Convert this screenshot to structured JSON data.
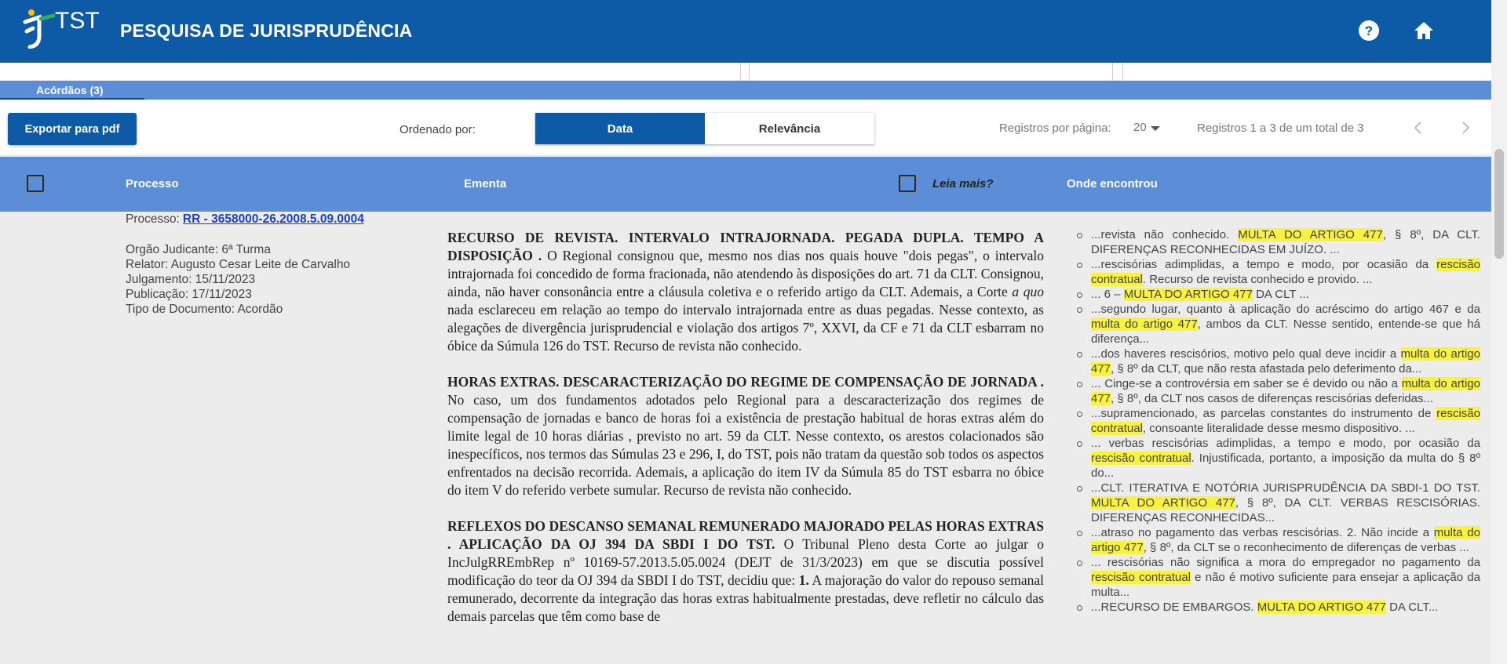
{
  "header": {
    "logo_text": "TST",
    "title": "PESQUISA DE JURISPRUDÊNCIA",
    "help_icon": "help-circle-icon",
    "home_icon": "home-icon"
  },
  "tabs": [
    {
      "label": "Acórdãos (3)",
      "active": true
    }
  ],
  "toolbar": {
    "export_label": "Exportar para pdf",
    "order_label": "Ordenado por:",
    "order_options": [
      "Data",
      "Relevância"
    ],
    "order_selected": "Data",
    "per_page_label": "Registros por página:",
    "per_page_value": "20",
    "records_text": "Registros 1 a 3 de um total de 3"
  },
  "columns": {
    "processo": "Processo",
    "ementa": "Ementa",
    "leia_mais": "Leia mais?",
    "onde": "Onde encontrou"
  },
  "result": {
    "processo_label": "Processo:",
    "processo_link": "RR - 3658000-26.2008.5.09.0004",
    "orgao": "Orgão Judicante: 6ª Turma",
    "relator": "Relator: Augusto Cesar Leite de Carvalho",
    "julgamento": "Julgamento: 15/11/2023",
    "publicacao": "Publicação: 17/11/2023",
    "tipo": "Tipo de Documento: Acordão",
    "ementa": [
      {
        "title": "RECURSO DE REVISTA. INTERVALO INTRAJORNADA. PEGADA DUPLA. TEMPO A DISPOSIÇÃO .",
        "body_a": " O Regional consignou que, mesmo nos dias nos quais houve \"dois pegas\", o intervalo intrajornada foi concedido de forma fracionada, não atendendo às disposições do art. 71 da CLT. Consignou, ainda, não haver consonância entre a cláusula coletiva e o referido artigo da CLT. Ademais, a Corte ",
        "italic": "a quo",
        "body_b": " nada esclareceu em relação ao tempo do intervalo intrajornada entre as duas pegadas. Nesse contexto, as alegações de divergência jurisprudencial e violação dos artigos 7º, XXVI, da CF e 71 da CLT esbarram no óbice da Súmula 126 do TST. Recurso de revista não conhecido."
      },
      {
        "title": "HORAS EXTRAS. DESCARACTERIZAÇÃO DO REGIME DE COMPENSAÇÃO DE JORNADA .",
        "body_a": " No caso, um dos fundamentos adotados pelo Regional para a descaracterização dos regimes de compensação de jornadas e banco de horas foi a existência de prestação habitual de horas extras além do limite legal de 10 horas diárias , previsto no art. 59 da CLT. Nesse contexto, os arestos colacionados são inespecíficos, nos termos das Súmulas 23 e 296, I, do TST, pois não tratam da questão sob todos os aspectos enfrentados na decisão recorrida. Ademais, a aplicação do item IV da Súmula 85 do TST esbarra no óbice do item V do referido verbete sumular. Recurso de revista não conhecido."
      },
      {
        "title": "REFLEXOS DO DESCANSO SEMANAL REMUNERADO MAJORADO PELAS HORAS EXTRAS . APLICAÇÃO DA OJ 394 DA SBDI I DO TST.",
        "body_a": " O Tribunal Pleno desta Corte ao julgar o IncJulgRREmbRep nº 10169-57.2013.5.05.0024 (DEJT de 31/3/2023) em que se discutia possível modificação do teor da OJ 394 da SBDI I do TST, decidiu que: ",
        "bold_tail": "1.",
        "body_b": " A majoração do valor do repouso semanal remunerado, decorrente da integração das horas extras habitualmente prestadas, deve refletir no cálculo das demais parcelas que têm como base de"
      }
    ],
    "onde": [
      [
        "...revista não conhecido. ",
        "MULTA DO ARTIGO 477",
        ", § 8º, DA CLT. DIFERENÇAS RECONHECIDAS EM JUÍZO. ..."
      ],
      [
        "...rescisórias adimplidas, a tempo e modo, por ocasião da ",
        "rescisão contratual",
        ". Recurso de revista conhecido e provido. ..."
      ],
      [
        "... 6 – ",
        "MULTA DO ARTIGO 477",
        " DA CLT ..."
      ],
      [
        "...segundo lugar, quanto à aplicação do acréscimo do artigo 467 e da ",
        "multa do artigo 477",
        ", ambos da CLT. Nesse sentido, entende-se que há diferença..."
      ],
      [
        "...dos haveres rescisórios, motivo pelo qual deve incidir a ",
        "multa do artigo 477",
        ", § 8º da CLT, que não resta afastada pelo deferimento da..."
      ],
      [
        "... Cinge-se a controvérsia em saber se é devido ou não a ",
        "multa do artigo 477",
        ", § 8º, da CLT nos casos de diferenças rescisórias deferidas..."
      ],
      [
        "...supramencionado, as parcelas constantes do instrumento de ",
        "rescisão contratual",
        ", consoante literalidade desse mesmo dispositivo. ..."
      ],
      [
        "... verbas rescisórias adimplidas, a tempo e modo, por ocasião da ",
        "rescisão contratual",
        ". Injustificada, portanto, a imposição da multa do § 8º do..."
      ],
      [
        "...CLT. ITERATIVA E NOTÓRIA JURISPRUDÊNCIA DA SBDI-1 DO TST. ",
        "MULTA DO ARTIGO 477",
        ", § 8º, DA CLT. VERBAS RESCISÓRIAS. DIFERENÇAS RECONHECIDAS..."
      ],
      [
        "...atraso no pagamento das verbas rescisórias. 2. Não incide a ",
        "multa do artigo 477",
        ", § 8º, da CLT se o reconhecimento de diferenças de verbas ..."
      ],
      [
        "... rescisórias não significa a mora do empregador no pagamento da ",
        "rescisão contratual",
        " e não é motivo suficiente para ensejar a aplicação da multa..."
      ],
      [
        "...RECURSO DE EMBARGOS. ",
        "MULTA DO ARTIGO 477",
        " DA CLT..."
      ]
    ]
  },
  "colors": {
    "primary": "#0d5aa7",
    "header_bar": "#5b8ed6",
    "highlight": "#f9f33e",
    "link": "#1a3fd1"
  }
}
